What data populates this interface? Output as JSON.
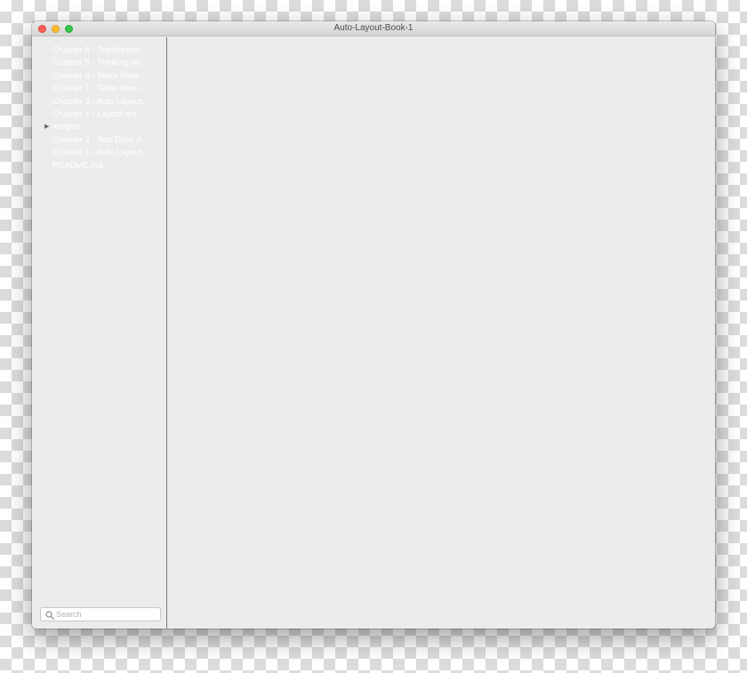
{
  "window": {
    "title": "Auto-Layout-Book-1"
  },
  "sidebar": {
    "items": [
      {
        "label": "Chapter 8 - Troublesho...",
        "expandable": false
      },
      {
        "label": "Chapter 5 - Thinking wi...",
        "expandable": false
      },
      {
        "label": "Chapter 6 - Stack View...",
        "expandable": false
      },
      {
        "label": "Chapter 7 - Table View...",
        "expandable": false
      },
      {
        "label": "Chapter 3 - Auto Layout...",
        "expandable": false
      },
      {
        "label": "Chapter 4 - Layout.md",
        "expandable": false
      },
      {
        "label": "images",
        "expandable": true,
        "disclosure_icon": "disclosure-triangle-right-icon"
      },
      {
        "label": "Chapter 2 - Test Drive A...",
        "expandable": false
      },
      {
        "label": "Chapter 1 - Auto Layout...",
        "expandable": false
      },
      {
        "label": "README.md",
        "expandable": false
      }
    ],
    "disclosure_glyph": "▶"
  },
  "search": {
    "placeholder": "Search",
    "value": "",
    "icon": "search-icon"
  },
  "colors": {
    "window_bg": "#ececec",
    "item_text": "#ffffff",
    "close": "#fc5f57",
    "minimize": "#fdbc2e",
    "zoom": "#34c84a"
  }
}
